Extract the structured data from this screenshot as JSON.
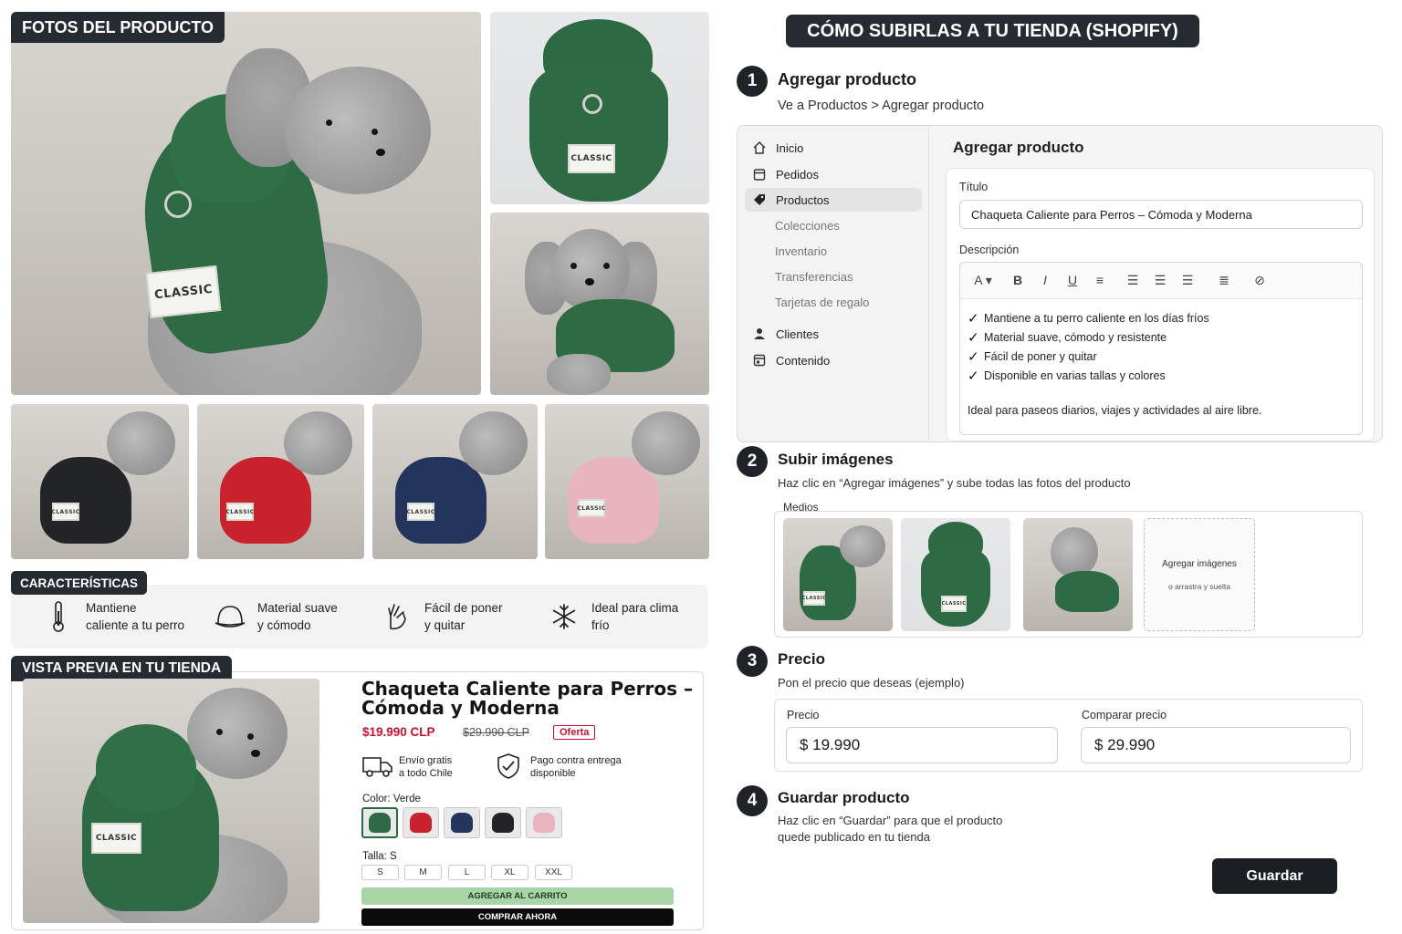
{
  "photos_section": {
    "label": "FOTOS DEL PRODUCTO",
    "patch_text": "CLASSIC",
    "coat_colors": [
      "#2e6b45",
      "#222428",
      "#c8232c",
      "#23355c",
      "#e8b4bf"
    ]
  },
  "features": {
    "label": "CARACTERÍSTICAS",
    "items": [
      {
        "line1": "Mantiene",
        "line2": "caliente a tu perro",
        "icon": "thermometer-icon"
      },
      {
        "line1": "Material suave",
        "line2": "y cómodo",
        "icon": "hat-icon"
      },
      {
        "line1": "Fácil de poner",
        "line2": "y quitar",
        "icon": "hand-icon"
      },
      {
        "line1": "Ideal para clima",
        "line2": "frío",
        "icon": "snowflake-icon"
      }
    ]
  },
  "preview": {
    "label": "VISTA PREVIA EN TU TIENDA",
    "title": "Chaqueta Caliente para Perros – Cómoda y Moderna",
    "price": "$19.990 CLP",
    "compare_price": "$29.990 CLP",
    "badge": "Oferta",
    "shipping_line1": "Envío gratis",
    "shipping_line2": "a todo Chile",
    "payment_line1": "Pago contra entrega",
    "payment_line2": "disponible",
    "color_label": "Color: Verde",
    "size_label": "Talla: S",
    "sizes": [
      "S",
      "M",
      "L",
      "XL",
      "XXL"
    ],
    "add_to_cart": "AGREGAR AL CARRITO",
    "buy_now": "COMPRAR AHORA"
  },
  "guide": {
    "header": "CÓMO SUBIRLAS A TU TIENDA (SHOPIFY)",
    "steps": [
      {
        "num": "1",
        "title": "Agregar producto",
        "sub": "Ve a Productos > Agregar producto"
      },
      {
        "num": "2",
        "title": "Subir imágenes",
        "sub": "Haz clic en “Agregar imágenes” y sube todas las fotos del producto"
      },
      {
        "num": "3",
        "title": "Precio",
        "sub": "Pon el precio que deseas (ejemplo)"
      },
      {
        "num": "4",
        "title": "Guardar producto",
        "sub_line1": "Haz clic en “Guardar” para que el producto",
        "sub_line2": "quede publicado en tu tienda"
      }
    ]
  },
  "admin": {
    "nav": {
      "inicio": "Inicio",
      "pedidos": "Pedidos",
      "productos": "Productos",
      "colecciones": "Colecciones",
      "inventario": "Inventario",
      "transferencias": "Transferencias",
      "tarjetas": "Tarjetas de regalo",
      "clientes": "Clientes",
      "contenido": "Contenido"
    },
    "page_title": "Agregar producto",
    "title_label": "Título",
    "title_value": "Chaqueta Caliente para Perros – Cómoda y Moderna",
    "description_label": "Descripción",
    "bullets": [
      "Mantiene a tu perro caliente en los días fríos",
      "Material suave, cómodo y resistente",
      "Fácil de poner y quitar",
      "Disponible en varias tallas y colores"
    ],
    "closing": "Ideal para paseos diarios, viajes y actividades al aire libre."
  },
  "media": {
    "label": "Medios",
    "add_images": "Agregar imágenes",
    "drag_hint": "o arrastra y suelta"
  },
  "pricing": {
    "price_label": "Precio",
    "price_value": "$  19.990",
    "compare_label": "Comparar precio",
    "compare_value": "$  29.990"
  },
  "save_button": "Guardar"
}
